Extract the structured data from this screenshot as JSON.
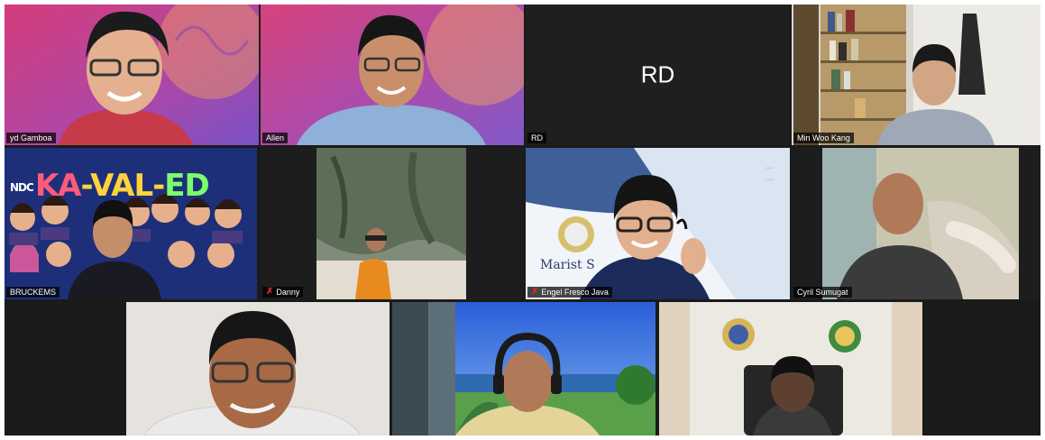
{
  "participants": [
    {
      "name": "yd Gamboa",
      "muted": false
    },
    {
      "name": "Allen",
      "muted": false
    },
    {
      "name": "RD",
      "muted": false,
      "initials": "RD"
    },
    {
      "name": "Min Woo Kang",
      "muted": false
    },
    {
      "name": "BRUCKEMS",
      "muted": false
    },
    {
      "name": "Danny",
      "muted": true
    },
    {
      "name": "Engel Fresco Java",
      "muted": true
    },
    {
      "name": "Cyril Sumugat",
      "muted": false
    },
    {
      "name": "",
      "muted": false
    },
    {
      "name": "",
      "muted": false
    },
    {
      "name": "",
      "muted": false
    }
  ],
  "tile_text": {
    "banner_prefix": "NDC",
    "banner_parts": [
      "KA",
      "-VAL-",
      "ED"
    ],
    "marist_logo_text": "Marist S",
    "ribbon_line1": "...",
    "ribbon_line2": "..."
  },
  "colors": {
    "active_speaker_border": "#e8e232",
    "muted_icon": "#e02828",
    "grid_background": "#1a1a1a"
  }
}
